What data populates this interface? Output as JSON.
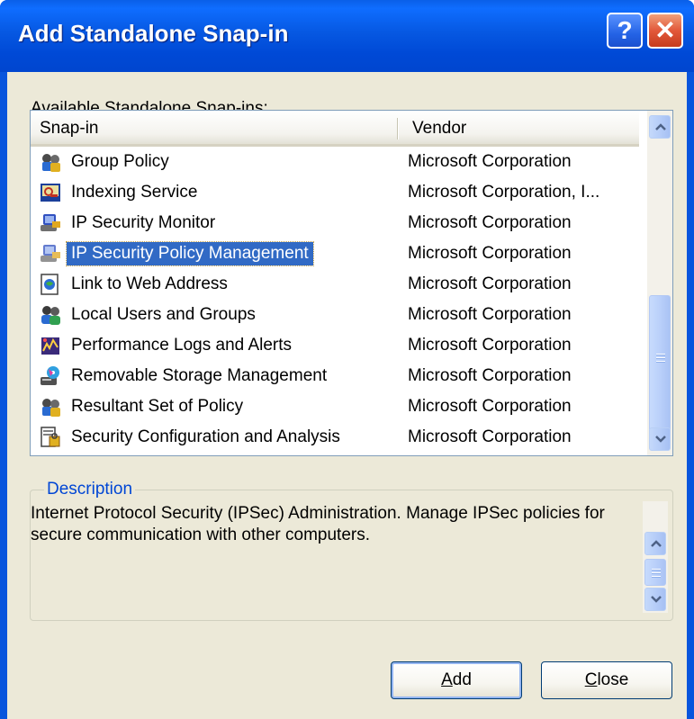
{
  "window": {
    "title": "Add Standalone Snap-in",
    "help_label": "?",
    "close_label": "✕"
  },
  "available_label": "Available Standalone Snap-ins:",
  "list": {
    "columns": {
      "snapin": "Snap-in",
      "vendor": "Vendor"
    },
    "rows": [
      {
        "name": "Group Policy",
        "vendor": "Microsoft Corporation",
        "icon": "group-policy-icon",
        "selected": false
      },
      {
        "name": "Indexing Service",
        "vendor": "Microsoft Corporation, I...",
        "icon": "indexing-service-icon",
        "selected": false
      },
      {
        "name": "IP Security Monitor",
        "vendor": "Microsoft Corporation",
        "icon": "ip-security-monitor-icon",
        "selected": false
      },
      {
        "name": "IP Security Policy Management",
        "vendor": "Microsoft Corporation",
        "icon": "ip-security-policy-icon",
        "selected": true
      },
      {
        "name": "Link to Web Address",
        "vendor": "Microsoft Corporation",
        "icon": "web-link-icon",
        "selected": false
      },
      {
        "name": "Local Users and Groups",
        "vendor": "Microsoft Corporation",
        "icon": "users-groups-icon",
        "selected": false
      },
      {
        "name": "Performance Logs and Alerts",
        "vendor": "Microsoft Corporation",
        "icon": "performance-logs-icon",
        "selected": false
      },
      {
        "name": "Removable Storage Management",
        "vendor": "Microsoft Corporation",
        "icon": "removable-storage-icon",
        "selected": false
      },
      {
        "name": "Resultant Set of Policy",
        "vendor": "Microsoft Corporation",
        "icon": "resultant-set-policy-icon",
        "selected": false
      },
      {
        "name": "Security Configuration and Analysis",
        "vendor": "Microsoft Corporation",
        "icon": "security-configuration-icon",
        "selected": false
      }
    ]
  },
  "description": {
    "legend": "Description",
    "text": "Internet Protocol Security (IPSec) Administration. Manage IPSec policies for secure communication with other computers."
  },
  "buttons": {
    "add": {
      "mnemonic": "A",
      "rest": "dd"
    },
    "close": {
      "mnemonic": "C",
      "rest": "lose"
    }
  },
  "colors": {
    "title_bar": "#0054e3",
    "selection": "#316ac5",
    "dialog_face": "#ece9d8",
    "legend_text": "#0046d5"
  }
}
